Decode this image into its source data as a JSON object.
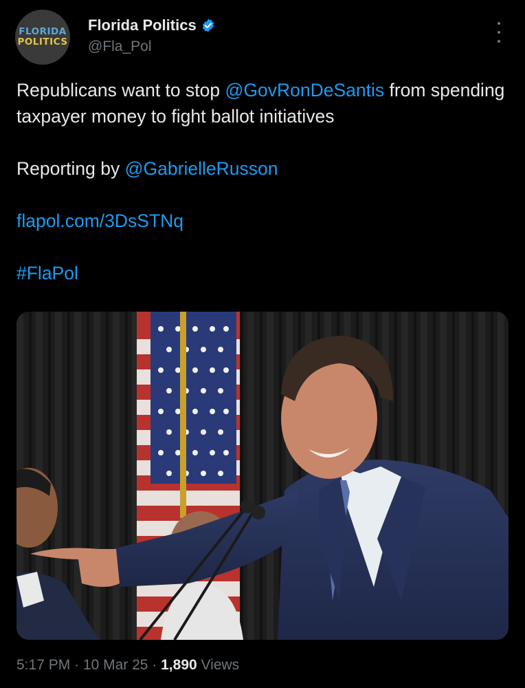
{
  "author": {
    "avatar_line1": "FLORIDA",
    "avatar_line2": "POLITICS",
    "display_name": "Florida Politics",
    "handle": "@Fla_Pol",
    "verified": true
  },
  "tweet": {
    "text_part1": "Republicans want to stop ",
    "mention_governor": "@GovRonDeSantis",
    "text_part2": " from spending taxpayer money to fight ballot initiatives",
    "reporting_prefix": "Reporting by ",
    "mention_reporter": "@GabrielleRusson",
    "link": "flapol.com/3DsSTNq",
    "hashtag": "#FlaPol"
  },
  "meta": {
    "time": "5:17 PM",
    "separator": " · ",
    "date": "10 Mar 25",
    "views_count": "1,890",
    "views_label": " Views"
  },
  "colors": {
    "background": "#000000",
    "link": "#1d9bf0",
    "secondary_text": "#71767b",
    "primary_text": "#e7e9ea",
    "verified_badge": "#1d9bf0"
  },
  "icons": {
    "verified": "verified-badge-icon",
    "more": "more-options-icon"
  }
}
